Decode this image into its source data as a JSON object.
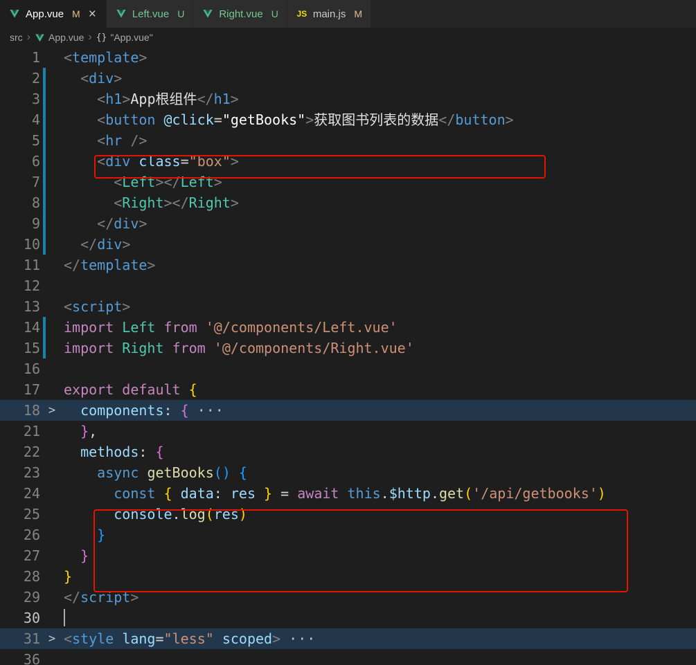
{
  "colors": {
    "git_modified": "#e2c08d",
    "git_untracked": "#73c991",
    "annotation_red": "#e51400",
    "git_gutter_modified": "#1b81a8"
  },
  "tabs": [
    {
      "name": "app-vue",
      "label": "App.vue",
      "badge": "M",
      "icon": "vue",
      "active": true,
      "has_close": true,
      "label_color": "#ffffff",
      "badge_color": "#e2c08d",
      "close_label": "×"
    },
    {
      "name": "left-vue",
      "label": "Left.vue",
      "badge": "U",
      "icon": "vue",
      "active": false,
      "has_close": false,
      "label_color": "#73c991",
      "badge_color": "#73c991"
    },
    {
      "name": "right-vue",
      "label": "Right.vue",
      "badge": "U",
      "icon": "vue",
      "active": false,
      "has_close": false,
      "label_color": "#73c991",
      "badge_color": "#73c991"
    },
    {
      "name": "main-js",
      "label": "main.js",
      "badge": "M",
      "icon": "js",
      "active": false,
      "has_close": false,
      "label_color": "#cccccc",
      "badge_color": "#e2c08d"
    }
  ],
  "breadcrumb": {
    "separator": "›",
    "items": [
      {
        "label": "src",
        "icon": null
      },
      {
        "label": "App.vue",
        "icon": "vue"
      },
      {
        "label": "\"App.vue\"",
        "icon": "object"
      }
    ]
  },
  "editor": {
    "fold_chevron": ">",
    "ellipsis": "···",
    "lines": [
      {
        "num": "1",
        "tokens": [
          [
            "<",
            "br"
          ],
          [
            "template",
            "tag"
          ],
          [
            ">",
            "br"
          ]
        ]
      },
      {
        "num": "2",
        "git": true,
        "tokens": [
          [
            "  ",
            "pl"
          ],
          [
            "<",
            "br"
          ],
          [
            "div",
            "tag"
          ],
          [
            ">",
            "br"
          ]
        ]
      },
      {
        "num": "3",
        "git": true,
        "tokens": [
          [
            "    ",
            "pl"
          ],
          [
            "<",
            "br"
          ],
          [
            "h1",
            "tag"
          ],
          [
            ">",
            "br"
          ],
          [
            "App根组件",
            "txt"
          ],
          [
            "</",
            "br"
          ],
          [
            "h1",
            "tag"
          ],
          [
            ">",
            "br"
          ]
        ]
      },
      {
        "num": "4",
        "git": true,
        "tokens": [
          [
            "    ",
            "pl"
          ],
          [
            "<",
            "br"
          ],
          [
            "button",
            "tag"
          ],
          [
            " ",
            "pl"
          ],
          [
            "@click",
            "attr"
          ],
          [
            "=",
            "pl"
          ],
          [
            "\"getBooks\"",
            "wht"
          ],
          [
            ">",
            "br"
          ],
          [
            "获取图书列表的数据",
            "txt"
          ],
          [
            "</",
            "br"
          ],
          [
            "button",
            "tag"
          ],
          [
            ">",
            "br"
          ]
        ]
      },
      {
        "num": "5",
        "git": true,
        "tokens": [
          [
            "    ",
            "pl"
          ],
          [
            "<",
            "br"
          ],
          [
            "hr",
            "tag"
          ],
          [
            " ",
            "pl"
          ],
          [
            "/>",
            "br"
          ]
        ]
      },
      {
        "num": "6",
        "git": true,
        "tokens": [
          [
            "    ",
            "pl"
          ],
          [
            "<",
            "br"
          ],
          [
            "div",
            "tag"
          ],
          [
            " ",
            "pl"
          ],
          [
            "class",
            "attr"
          ],
          [
            "=",
            "pl"
          ],
          [
            "\"box\"",
            "str"
          ],
          [
            ">",
            "br"
          ]
        ]
      },
      {
        "num": "7",
        "git": true,
        "tokens": [
          [
            "      ",
            "pl"
          ],
          [
            "<",
            "br"
          ],
          [
            "Left",
            "cls"
          ],
          [
            "></",
            "br"
          ],
          [
            "Left",
            "cls"
          ],
          [
            ">",
            "br"
          ]
        ]
      },
      {
        "num": "8",
        "git": true,
        "tokens": [
          [
            "      ",
            "pl"
          ],
          [
            "<",
            "br"
          ],
          [
            "Right",
            "cls"
          ],
          [
            "></",
            "br"
          ],
          [
            "Right",
            "cls"
          ],
          [
            ">",
            "br"
          ]
        ]
      },
      {
        "num": "9",
        "git": true,
        "tokens": [
          [
            "    ",
            "pl"
          ],
          [
            "</",
            "br"
          ],
          [
            "div",
            "tag"
          ],
          [
            ">",
            "br"
          ]
        ]
      },
      {
        "num": "10",
        "git": true,
        "tokens": [
          [
            "  ",
            "pl"
          ],
          [
            "</",
            "br"
          ],
          [
            "div",
            "tag"
          ],
          [
            ">",
            "br"
          ]
        ]
      },
      {
        "num": "11",
        "tokens": [
          [
            "</",
            "br"
          ],
          [
            "template",
            "tag"
          ],
          [
            ">",
            "br"
          ]
        ]
      },
      {
        "num": "12",
        "tokens": []
      },
      {
        "num": "13",
        "tokens": [
          [
            "<",
            "br"
          ],
          [
            "script",
            "tag"
          ],
          [
            ">",
            "br"
          ]
        ]
      },
      {
        "num": "14",
        "git": true,
        "tokens": [
          [
            "import",
            "kw"
          ],
          [
            " ",
            "pl"
          ],
          [
            "Left",
            "cls"
          ],
          [
            " ",
            "pl"
          ],
          [
            "from",
            "kw"
          ],
          [
            " ",
            "pl"
          ],
          [
            "'@/components/Left.vue'",
            "str"
          ]
        ]
      },
      {
        "num": "15",
        "git": true,
        "tokens": [
          [
            "import",
            "kw"
          ],
          [
            " ",
            "pl"
          ],
          [
            "Right",
            "cls"
          ],
          [
            " ",
            "pl"
          ],
          [
            "from",
            "kw"
          ],
          [
            " ",
            "pl"
          ],
          [
            "'@/components/Right.vue'",
            "str"
          ]
        ]
      },
      {
        "num": "16",
        "tokens": []
      },
      {
        "num": "17",
        "tokens": [
          [
            "export",
            "kw"
          ],
          [
            " ",
            "pl"
          ],
          [
            "default",
            "kw"
          ],
          [
            " ",
            "pl"
          ],
          [
            "{",
            "b1"
          ]
        ]
      },
      {
        "num": "18",
        "fold": true,
        "hl": true,
        "tokens": [
          [
            "  ",
            "pl"
          ],
          [
            "components",
            "attr"
          ],
          [
            ":",
            "pl"
          ],
          [
            " ",
            "pl"
          ],
          [
            "{",
            "b2"
          ],
          [
            " ",
            "pl"
          ],
          [
            "···",
            "fold"
          ]
        ]
      },
      {
        "num": "21",
        "tokens": [
          [
            "  ",
            "pl"
          ],
          [
            "}",
            "b2"
          ],
          [
            ",",
            "pl"
          ]
        ]
      },
      {
        "num": "22",
        "tokens": [
          [
            "  ",
            "pl"
          ],
          [
            "methods",
            "attr"
          ],
          [
            ":",
            "pl"
          ],
          [
            " ",
            "pl"
          ],
          [
            "{",
            "b2"
          ]
        ]
      },
      {
        "num": "23",
        "tokens": [
          [
            "    ",
            "pl"
          ],
          [
            "async",
            "kwb"
          ],
          [
            " ",
            "pl"
          ],
          [
            "getBooks",
            "fn"
          ],
          [
            "(",
            "b3"
          ],
          [
            ")",
            "b3"
          ],
          [
            " ",
            "pl"
          ],
          [
            "{",
            "b3"
          ]
        ]
      },
      {
        "num": "24",
        "tokens": [
          [
            "      ",
            "pl"
          ],
          [
            "const",
            "kwb"
          ],
          [
            " ",
            "pl"
          ],
          [
            "{",
            "b1"
          ],
          [
            " ",
            "pl"
          ],
          [
            "data",
            "attr"
          ],
          [
            ":",
            "pl"
          ],
          [
            " ",
            "pl"
          ],
          [
            "res",
            "attr"
          ],
          [
            " ",
            "pl"
          ],
          [
            "}",
            "b1"
          ],
          [
            " ",
            "pl"
          ],
          [
            "=",
            "pl"
          ],
          [
            " ",
            "pl"
          ],
          [
            "await",
            "kw"
          ],
          [
            " ",
            "pl"
          ],
          [
            "this",
            "kwb"
          ],
          [
            ".",
            "pl"
          ],
          [
            "$http",
            "attr"
          ],
          [
            ".",
            "pl"
          ],
          [
            "get",
            "fn"
          ],
          [
            "(",
            "b1"
          ],
          [
            "'/api/getbooks'",
            "str"
          ],
          [
            ")",
            "b1"
          ]
        ]
      },
      {
        "num": "25",
        "tokens": [
          [
            "      ",
            "pl"
          ],
          [
            "console",
            "attr"
          ],
          [
            ".",
            "pl"
          ],
          [
            "log",
            "fn"
          ],
          [
            "(",
            "b1"
          ],
          [
            "res",
            "attr"
          ],
          [
            ")",
            "b1"
          ]
        ]
      },
      {
        "num": "26",
        "tokens": [
          [
            "    ",
            "pl"
          ],
          [
            "}",
            "b3"
          ]
        ]
      },
      {
        "num": "27",
        "tokens": [
          [
            "  ",
            "pl"
          ],
          [
            "}",
            "b2"
          ]
        ]
      },
      {
        "num": "28",
        "tokens": [
          [
            "}",
            "b1"
          ]
        ]
      },
      {
        "num": "29",
        "tokens": [
          [
            "</",
            "br"
          ],
          [
            "script",
            "tag"
          ],
          [
            ">",
            "br"
          ]
        ]
      },
      {
        "num": "30",
        "cur": true,
        "cursor": true,
        "tokens": []
      },
      {
        "num": "31",
        "fold": true,
        "hl": true,
        "tokens": [
          [
            "<",
            "br"
          ],
          [
            "style",
            "tag"
          ],
          [
            " ",
            "pl"
          ],
          [
            "lang",
            "attr"
          ],
          [
            "=",
            "pl"
          ],
          [
            "\"less\"",
            "str"
          ],
          [
            " ",
            "pl"
          ],
          [
            "scoped",
            "attr"
          ],
          [
            ">",
            "br"
          ],
          [
            " ",
            "pl"
          ],
          [
            "···",
            "fold"
          ]
        ]
      },
      {
        "num": "36",
        "tokens": []
      }
    ]
  },
  "annotations": {
    "color": "#e51400",
    "boxes": [
      {
        "name": "annotation-box-button",
        "target": "line 4 button element"
      },
      {
        "name": "annotation-box-getbooks",
        "target": "lines 23-26 getBooks method"
      }
    ]
  }
}
